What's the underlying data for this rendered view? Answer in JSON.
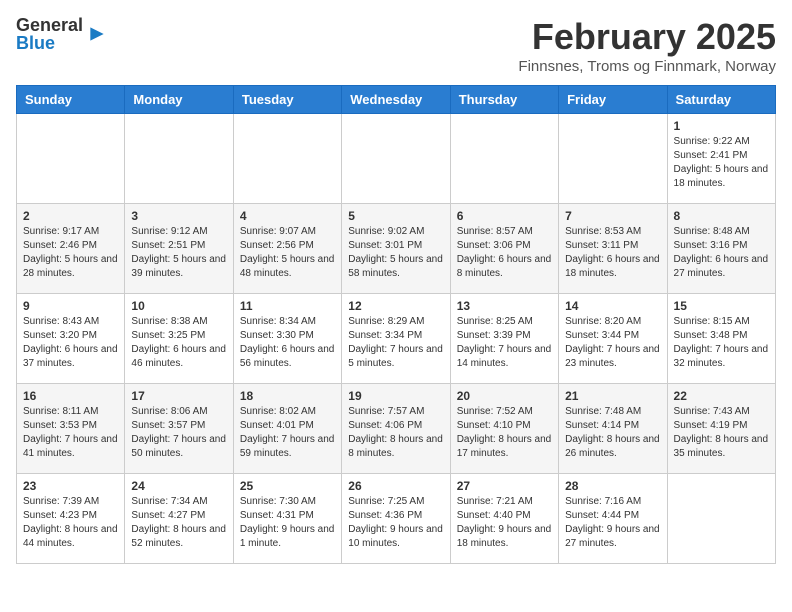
{
  "header": {
    "logo_general": "General",
    "logo_blue": "Blue",
    "title": "February 2025",
    "subtitle": "Finnsnes, Troms og Finnmark, Norway"
  },
  "days_of_week": [
    "Sunday",
    "Monday",
    "Tuesday",
    "Wednesday",
    "Thursday",
    "Friday",
    "Saturday"
  ],
  "weeks": [
    [
      {
        "day": "",
        "info": ""
      },
      {
        "day": "",
        "info": ""
      },
      {
        "day": "",
        "info": ""
      },
      {
        "day": "",
        "info": ""
      },
      {
        "day": "",
        "info": ""
      },
      {
        "day": "",
        "info": ""
      },
      {
        "day": "1",
        "info": "Sunrise: 9:22 AM\nSunset: 2:41 PM\nDaylight: 5 hours and 18 minutes."
      }
    ],
    [
      {
        "day": "2",
        "info": "Sunrise: 9:17 AM\nSunset: 2:46 PM\nDaylight: 5 hours and 28 minutes."
      },
      {
        "day": "3",
        "info": "Sunrise: 9:12 AM\nSunset: 2:51 PM\nDaylight: 5 hours and 39 minutes."
      },
      {
        "day": "4",
        "info": "Sunrise: 9:07 AM\nSunset: 2:56 PM\nDaylight: 5 hours and 48 minutes."
      },
      {
        "day": "5",
        "info": "Sunrise: 9:02 AM\nSunset: 3:01 PM\nDaylight: 5 hours and 58 minutes."
      },
      {
        "day": "6",
        "info": "Sunrise: 8:57 AM\nSunset: 3:06 PM\nDaylight: 6 hours and 8 minutes."
      },
      {
        "day": "7",
        "info": "Sunrise: 8:53 AM\nSunset: 3:11 PM\nDaylight: 6 hours and 18 minutes."
      },
      {
        "day": "8",
        "info": "Sunrise: 8:48 AM\nSunset: 3:16 PM\nDaylight: 6 hours and 27 minutes."
      }
    ],
    [
      {
        "day": "9",
        "info": "Sunrise: 8:43 AM\nSunset: 3:20 PM\nDaylight: 6 hours and 37 minutes."
      },
      {
        "day": "10",
        "info": "Sunrise: 8:38 AM\nSunset: 3:25 PM\nDaylight: 6 hours and 46 minutes."
      },
      {
        "day": "11",
        "info": "Sunrise: 8:34 AM\nSunset: 3:30 PM\nDaylight: 6 hours and 56 minutes."
      },
      {
        "day": "12",
        "info": "Sunrise: 8:29 AM\nSunset: 3:34 PM\nDaylight: 7 hours and 5 minutes."
      },
      {
        "day": "13",
        "info": "Sunrise: 8:25 AM\nSunset: 3:39 PM\nDaylight: 7 hours and 14 minutes."
      },
      {
        "day": "14",
        "info": "Sunrise: 8:20 AM\nSunset: 3:44 PM\nDaylight: 7 hours and 23 minutes."
      },
      {
        "day": "15",
        "info": "Sunrise: 8:15 AM\nSunset: 3:48 PM\nDaylight: 7 hours and 32 minutes."
      }
    ],
    [
      {
        "day": "16",
        "info": "Sunrise: 8:11 AM\nSunset: 3:53 PM\nDaylight: 7 hours and 41 minutes."
      },
      {
        "day": "17",
        "info": "Sunrise: 8:06 AM\nSunset: 3:57 PM\nDaylight: 7 hours and 50 minutes."
      },
      {
        "day": "18",
        "info": "Sunrise: 8:02 AM\nSunset: 4:01 PM\nDaylight: 7 hours and 59 minutes."
      },
      {
        "day": "19",
        "info": "Sunrise: 7:57 AM\nSunset: 4:06 PM\nDaylight: 8 hours and 8 minutes."
      },
      {
        "day": "20",
        "info": "Sunrise: 7:52 AM\nSunset: 4:10 PM\nDaylight: 8 hours and 17 minutes."
      },
      {
        "day": "21",
        "info": "Sunrise: 7:48 AM\nSunset: 4:14 PM\nDaylight: 8 hours and 26 minutes."
      },
      {
        "day": "22",
        "info": "Sunrise: 7:43 AM\nSunset: 4:19 PM\nDaylight: 8 hours and 35 minutes."
      }
    ],
    [
      {
        "day": "23",
        "info": "Sunrise: 7:39 AM\nSunset: 4:23 PM\nDaylight: 8 hours and 44 minutes."
      },
      {
        "day": "24",
        "info": "Sunrise: 7:34 AM\nSunset: 4:27 PM\nDaylight: 8 hours and 52 minutes."
      },
      {
        "day": "25",
        "info": "Sunrise: 7:30 AM\nSunset: 4:31 PM\nDaylight: 9 hours and 1 minute."
      },
      {
        "day": "26",
        "info": "Sunrise: 7:25 AM\nSunset: 4:36 PM\nDaylight: 9 hours and 10 minutes."
      },
      {
        "day": "27",
        "info": "Sunrise: 7:21 AM\nSunset: 4:40 PM\nDaylight: 9 hours and 18 minutes."
      },
      {
        "day": "28",
        "info": "Sunrise: 7:16 AM\nSunset: 4:44 PM\nDaylight: 9 hours and 27 minutes."
      },
      {
        "day": "",
        "info": ""
      }
    ]
  ]
}
